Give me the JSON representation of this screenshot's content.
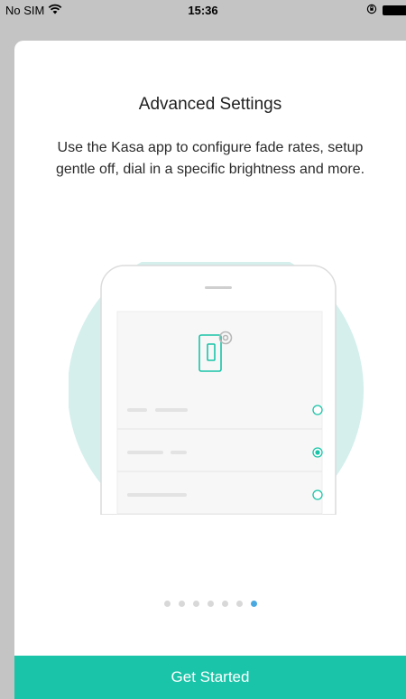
{
  "status_bar": {
    "carrier": "No SIM",
    "time": "15:36"
  },
  "onboarding": {
    "title": "Advanced Settings",
    "description": "Use the Kasa app to configure fade rates, setup gentle off, dial in a specific brightness and more.",
    "pager": {
      "total": 7,
      "active_index": 6
    },
    "cta_label": "Get Started"
  },
  "illustration": {
    "options": [
      {
        "selected": false
      },
      {
        "selected": true
      },
      {
        "selected": false
      }
    ]
  },
  "colors": {
    "accent": "#1ac4a8",
    "circle": "#d4efec",
    "active_dot": "#4aa8e0",
    "inactive_dot": "#d8d8d8"
  }
}
